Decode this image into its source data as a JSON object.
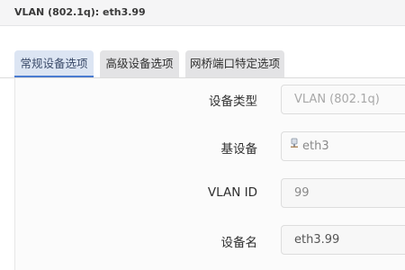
{
  "window": {
    "title": "VLAN (802.1q): eth3.99"
  },
  "tabs": [
    {
      "label": "常规设备选项",
      "active": true
    },
    {
      "label": "高级设备选项",
      "active": false
    },
    {
      "label": "网桥端口特定选项",
      "active": false
    }
  ],
  "form": {
    "device_type": {
      "label": "设备类型",
      "value": "VLAN (802.1q)"
    },
    "base_device": {
      "label": "基设备",
      "value": "eth3",
      "icon": "network-port-icon"
    },
    "vlan_id": {
      "label": "VLAN ID",
      "value": "99"
    },
    "device_name": {
      "label": "设备名",
      "value": "eth3.99"
    }
  },
  "colors": {
    "active_tab_bg": "#dce5f3",
    "active_tab_border": "#4a7bd0",
    "inactive_tab_bg": "#e3e3e5"
  }
}
